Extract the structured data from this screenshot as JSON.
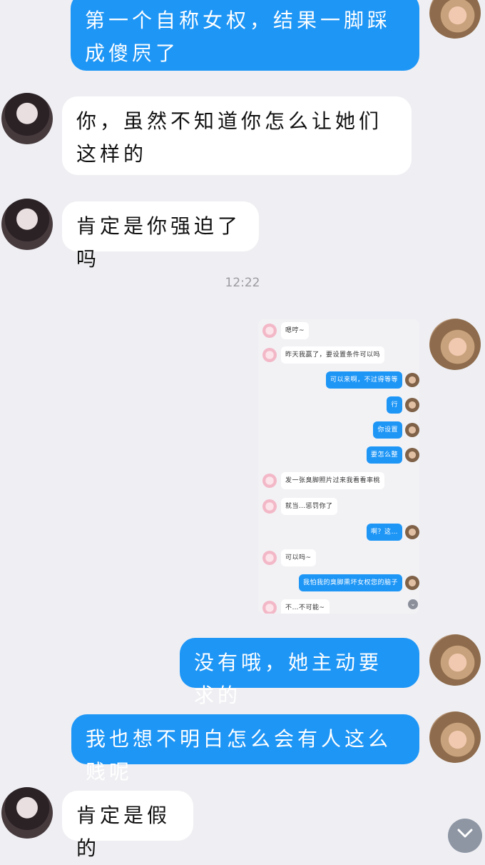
{
  "messages": [
    {
      "side": "right",
      "text": "第一个自称女权，结果一脚踩成傻屄了"
    },
    {
      "side": "left",
      "text": "你，虽然不知道你怎么让她们这样的"
    },
    {
      "side": "left",
      "text": "肯定是你强迫了吗"
    },
    {
      "side": "right",
      "text": "没有哦，她主动要求的"
    },
    {
      "side": "right",
      "text": "我也想不明白怎么会有人这么贱呢"
    },
    {
      "side": "left",
      "text": "肯定是假的"
    }
  ],
  "timestamp": "12:22",
  "embedded_chat": [
    {
      "side": "left",
      "text": "嗯哼~"
    },
    {
      "side": "left",
      "text": "昨天我赢了，要设置条件可以吗"
    },
    {
      "side": "right",
      "text": "可以来啊，不过得等等"
    },
    {
      "side": "right",
      "text": "行"
    },
    {
      "side": "right",
      "text": "你设置"
    },
    {
      "side": "right",
      "text": "要怎么整"
    },
    {
      "side": "left",
      "text": "发一张臭脚照片过来我看看率桃"
    },
    {
      "side": "left",
      "text": "就当…惩罚你了"
    },
    {
      "side": "right",
      "text": "啊？这…"
    },
    {
      "side": "left",
      "text": "可以吗~"
    },
    {
      "side": "right",
      "text": "我怕我的臭脚熏坏女权您的脑子"
    },
    {
      "side": "left",
      "text": "不…不可能~"
    }
  ],
  "icons": {
    "scroll_down": "chevron-down-icon"
  }
}
